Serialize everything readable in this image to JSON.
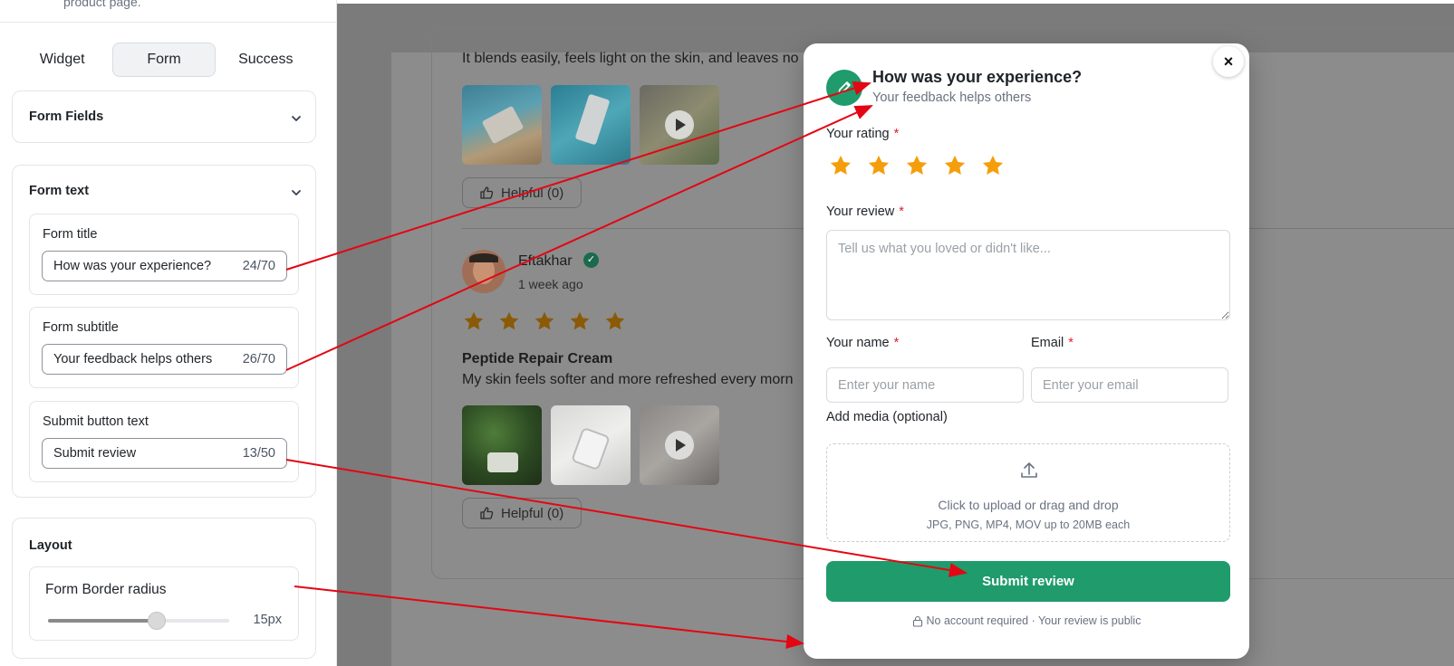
{
  "panel": {
    "top_note": "product page.",
    "tabs": [
      {
        "label": "Widget"
      },
      {
        "label": "Form"
      },
      {
        "label": "Success"
      }
    ],
    "form_fields_title": "Form Fields",
    "form_text_title": "Form text",
    "form_title": {
      "label": "Form title",
      "value": "How was your experience?",
      "count": "24/70"
    },
    "form_subtitle": {
      "label": "Form subtitle",
      "value": "Your feedback helps others",
      "count": "26/70"
    },
    "submit_text": {
      "label": "Submit button text",
      "value": "Submit review",
      "count": "13/50"
    },
    "layout_title": "Layout",
    "border_radius": {
      "label": "Form Border radius",
      "value": "15px",
      "level": 0.6
    }
  },
  "background": {
    "review1_text": "It blends easily, feels light on the skin, and leaves no",
    "helpful_label": "Helpful (0)",
    "review2": {
      "name": "Eftakhar",
      "date": "1 week ago",
      "stars": 5,
      "title": "Peptide Repair Cream",
      "text": "My skin feels softer and more refreshed every morn"
    }
  },
  "modal": {
    "close": "×",
    "title": "How was your experience?",
    "subtitle": "Your feedback helps others",
    "rating_label": "Your rating",
    "rating_stars": 5,
    "review_label": "Your review",
    "review_placeholder": "Tell us what you loved or didn't like...",
    "name_label": "Your name",
    "name_placeholder": "Enter your name",
    "email_label": "Email",
    "email_placeholder": "Enter your email",
    "required_mark": "*",
    "media_label": "Add media (optional)",
    "media_main": "Click to upload or drag and drop",
    "media_hint": "JPG, PNG, MP4, MOV up to 20MB each",
    "submit": "Submit review",
    "footer": "No account required · Your review is public"
  },
  "colors": {
    "accent": "#1f9b6c",
    "star": "#f59e0b",
    "annotation_arrow": "#e30613"
  }
}
